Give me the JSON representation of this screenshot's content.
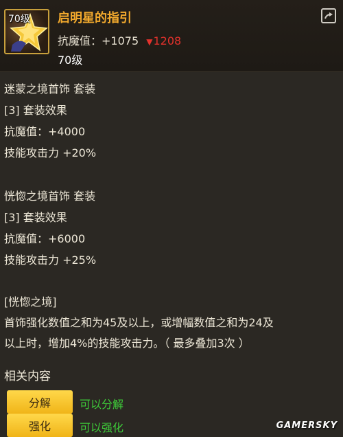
{
  "item": {
    "level_badge": "70级",
    "name": "启明星的指引",
    "stat_label": "抗魔值：+1075",
    "stat_decrease": "1208",
    "level": "70级",
    "icon": "star-icon",
    "share_icon": "share-icon"
  },
  "sets": [
    {
      "title": "迷蒙之境首饰  套装",
      "effect": "[3] 套装效果",
      "stat1": "抗魔值：+4000",
      "stat2": "技能攻击力 +20%"
    },
    {
      "title": "恍惚之境首饰  套装",
      "effect": "[3] 套装效果",
      "stat1": "抗魔值：+6000",
      "stat2": "技能攻击力 +25%"
    }
  ],
  "description": {
    "header": "[恍惚之境]",
    "line1": "首饰强化数值之和为45及以上，或增幅数值之和为24及",
    "line2": "以上时，增加4%的技能攻击力。（ 最多叠加3次 ）"
  },
  "related": {
    "title": "相关内容",
    "actions": [
      {
        "label": "分解",
        "hint": "可以分解"
      },
      {
        "label": "强化",
        "hint": "可以强化"
      }
    ]
  },
  "watermark": "GAMERSKY",
  "colors": {
    "background": "#2b2823",
    "item_name": "#f2a92d",
    "decrease": "#e2322c",
    "hint_green": "#3ecb39",
    "button_yellow": "#ffd84a"
  }
}
